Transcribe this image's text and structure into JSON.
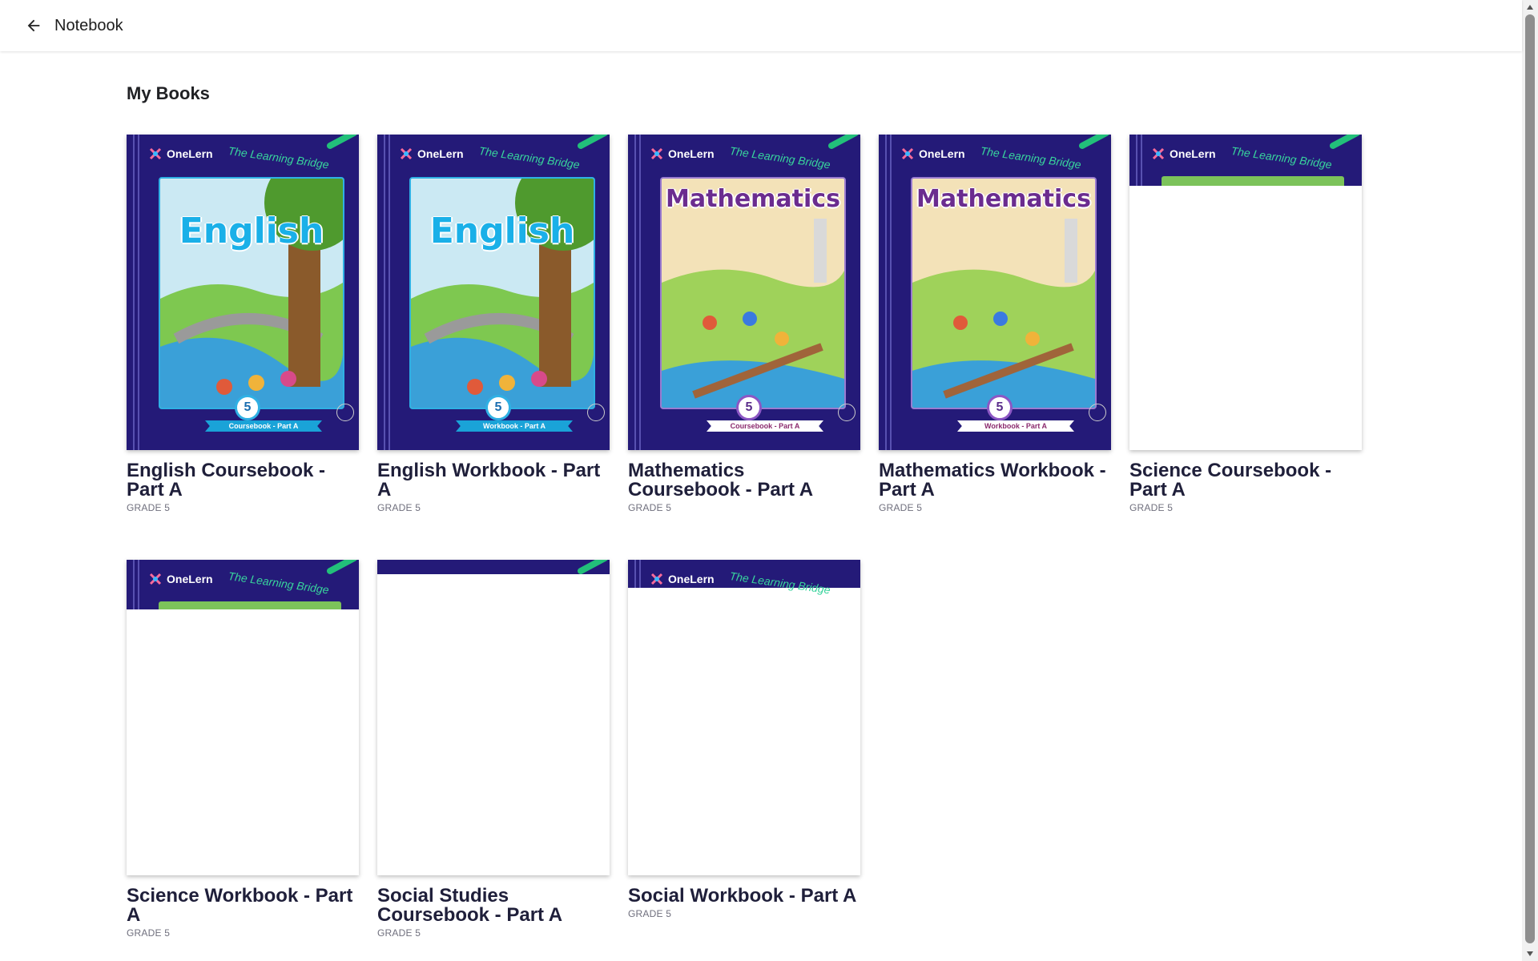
{
  "header": {
    "title": "Notebook"
  },
  "main": {
    "section_title": "My Books",
    "books": [
      {
        "title": "English Coursebook - Part A",
        "grade": "GRADE 5",
        "subject": "English",
        "type": "Coursebook - Part A",
        "grade_num": "5",
        "brand": "OneLern",
        "tagline": "The Learning Bridge"
      },
      {
        "title": "English Workbook - Part A",
        "grade": "GRADE 5",
        "subject": "English",
        "type": "Workbook - Part A",
        "grade_num": "5",
        "brand": "OneLern",
        "tagline": "The Learning Bridge"
      },
      {
        "title": "Mathematics Coursebook - Part A",
        "grade": "GRADE 5",
        "subject": "Mathematics",
        "type": "Coursebook - Part A",
        "grade_num": "5",
        "brand": "OneLern",
        "tagline": "The Learning Bridge"
      },
      {
        "title": "Mathematics Workbook - Part A",
        "grade": "GRADE 5",
        "subject": "Mathematics",
        "type": "Workbook - Part A",
        "grade_num": "5",
        "brand": "OneLern",
        "tagline": "The Learning Bridge"
      },
      {
        "title": "Science Coursebook - Part A",
        "grade": "GRADE 5",
        "brand": "OneLern",
        "tagline": "The Learning Bridge"
      },
      {
        "title": "Science Workbook - Part A",
        "grade": "GRADE 5",
        "brand": "OneLern",
        "tagline": "The Learning Bridge"
      },
      {
        "title": "Social Studies Coursebook - Part A",
        "grade": "GRADE 5"
      },
      {
        "title": "Social Workbook - Part A",
        "grade": "GRADE 5",
        "brand": "OneLern",
        "tagline": "The Learning Bridge"
      }
    ]
  }
}
